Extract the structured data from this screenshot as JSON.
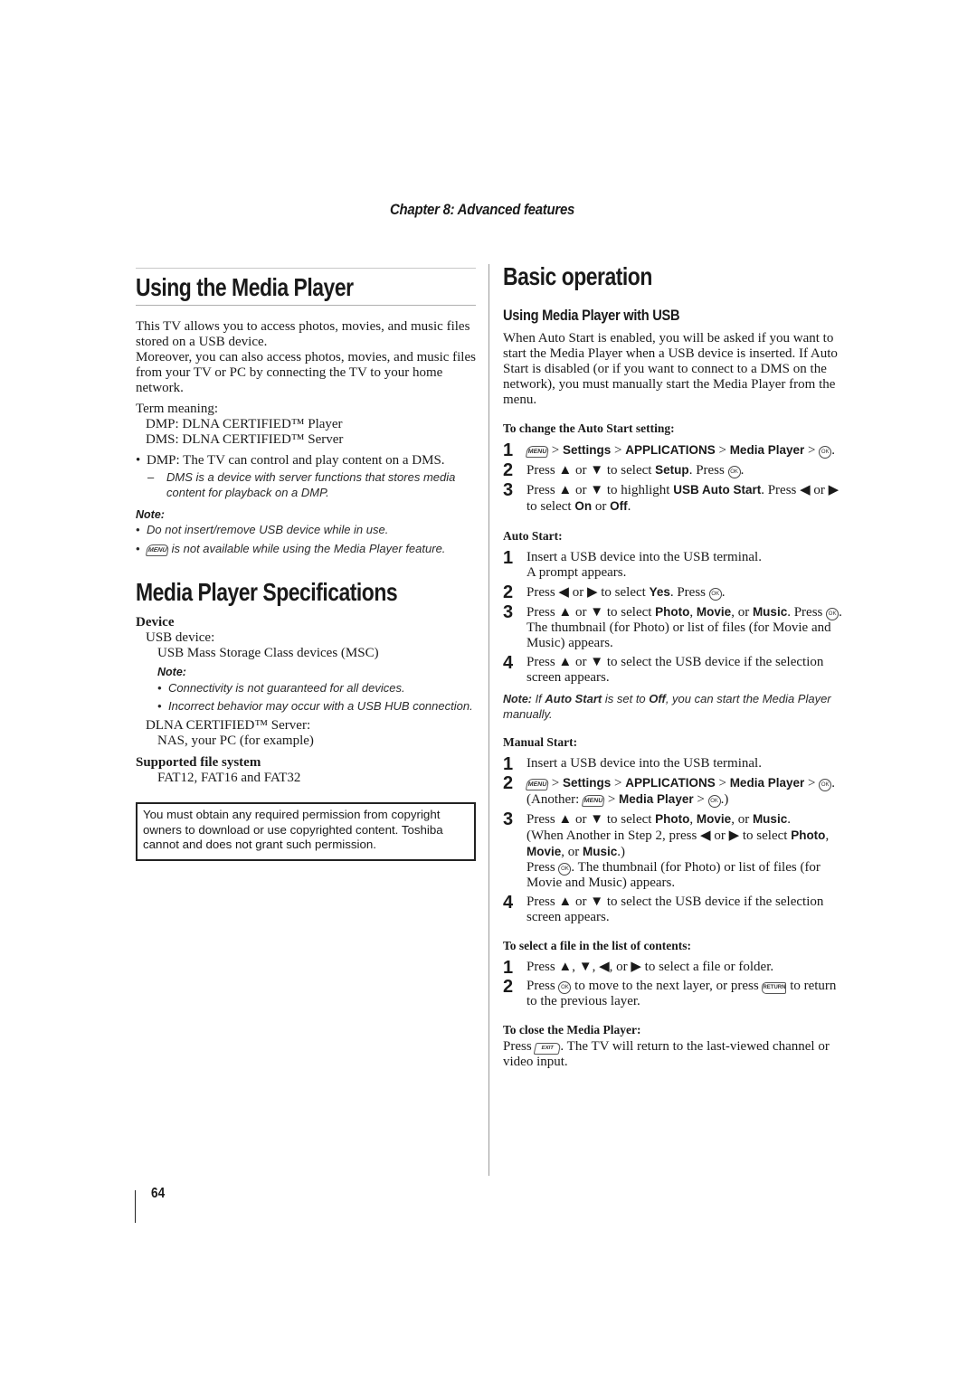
{
  "header": {
    "chapter": "Chapter 8: Advanced features"
  },
  "left": {
    "title": "Using the Media Player",
    "intro": [
      "This TV allows you to access photos, movies, and music files stored on a USB device.",
      "Moreover, you can also access photos, movies, and music files from your TV or PC by connecting the TV to your home network."
    ],
    "term_label": "Term meaning:",
    "terms": [
      "DMP: DLNA CERTIFIED™ Player",
      "DMS: DLNA CERTIFIED™ Server"
    ],
    "dmp_bullet": "DMP: The TV can control and play content on a DMS.",
    "dms_sub": "DMS is a device with server functions that stores media content for playback on a DMP.",
    "note_label": "Note:",
    "notes": [
      "Do not insert/remove USB device while in use.",
      "is not available while using the Media Player feature."
    ],
    "specs_title": "Media Player Specifications",
    "device_heading": "Device",
    "usb_label": "USB device:",
    "usb_value": "USB Mass Storage Class devices (MSC)",
    "device_note_label": "Note:",
    "device_notes": [
      "Connectivity is not guaranteed for all devices.",
      "Incorrect behavior may occur with a USB HUB connection."
    ],
    "dlna_label": "DLNA CERTIFIED™ Server:",
    "dlna_value": "NAS, your PC (for example)",
    "fs_heading": "Supported file system",
    "fs_value": "FAT12, FAT16 and FAT32",
    "copyright_notice": "You must obtain any required permission from copyright owners to download or use copyrighted content. Toshiba cannot and does not grant such permission."
  },
  "icons": {
    "menu": "MENU",
    "ok": "OK",
    "return": "RETURN",
    "exit": "EXIT"
  },
  "right": {
    "title": "Basic operation",
    "subtitle": "Using Media Player with USB",
    "intro": "When Auto Start is enabled, you will be asked if you want to start the Media Player when a USB device is inserted. If Auto Start is disabled (or if you want to connect to a DMS on the network), you must manually start the Media Player from the menu.",
    "change_heading": "To change the Auto Start setting:",
    "change_steps": {
      "s1": {
        "num": "1",
        "path": [
          "Settings",
          "APPLICATIONS",
          "Media Player"
        ]
      },
      "s2": {
        "num": "2",
        "a": "Press ▲ or ▼ to select ",
        "b": "Setup",
        "c": ". Press "
      },
      "s3": {
        "num": "3",
        "a": "Press ▲ or ▼ to highlight ",
        "b": "USB Auto Start",
        "c": ". Press ◀ or ▶ to select ",
        "d": "On",
        "e": " or ",
        "f": "Off",
        "g": "."
      }
    },
    "auto_heading": "Auto Start:",
    "auto_steps": {
      "s1": {
        "num": "1",
        "a": "Insert a USB device into the USB terminal.",
        "b": "A prompt appears."
      },
      "s2": {
        "num": "2",
        "a": "Press ◀ or ▶ to select ",
        "b": "Yes",
        "c": ". Press "
      },
      "s3": {
        "num": "3",
        "a": "Press ▲ or ▼ to select ",
        "photo": "Photo",
        "movie": "Movie",
        "music": "Music",
        "sep1": ", ",
        "sep2": ", or ",
        "c": ". Press ",
        "d": ". The thumbnail (for Photo) or list of files (for Movie and Music) appears."
      },
      "s4": {
        "num": "4",
        "a": "Press ▲ or ▼ to select the USB device if the selection screen appears."
      }
    },
    "auto_note": {
      "label": "Note:",
      "a": " If ",
      "b": "Auto Start",
      "c": " is set to ",
      "d": "Off",
      "e": ", you can start the Media Player manually."
    },
    "manual_heading": "Manual Start:",
    "manual_steps": {
      "s1": {
        "num": "1",
        "a": "Insert a USB device into the USB terminal."
      },
      "s2": {
        "num": "2",
        "path": [
          "Settings",
          "APPLICATIONS",
          "Media Player"
        ],
        "another_a": "(Another: ",
        "another_b": "Media Player",
        "another_c": ".)"
      },
      "s3": {
        "num": "3",
        "a": "Press ▲ or ▼ to select ",
        "photo": "Photo",
        "movie": "Movie",
        "music": "Music",
        "sep1": ", ",
        "sep2": ", or ",
        "b": ".",
        "c": "(When Another in Step 2, press ◀ or ▶ to select ",
        "d": ".)",
        "e": "Press ",
        "f": ". The thumbnail (for Photo) or list of files (for Movie and Music) appears."
      },
      "s4": {
        "num": "4",
        "a": "Press ▲ or ▼ to select the USB device if the selection screen appears."
      }
    },
    "select_heading": "To select a file in the list of contents:",
    "select_steps": {
      "s1": {
        "num": "1",
        "a": "Press ▲, ▼, ◀, or ▶ to select a file or folder."
      },
      "s2": {
        "num": "2",
        "a": "Press ",
        "b": " to move to the next layer, or press ",
        "c": " to return to the previous layer."
      }
    },
    "close_heading": "To close the Media Player:",
    "close_a": "Press ",
    "close_b": ". The TV will return to the last-viewed channel or video input."
  },
  "footer": {
    "page_number": "64"
  }
}
